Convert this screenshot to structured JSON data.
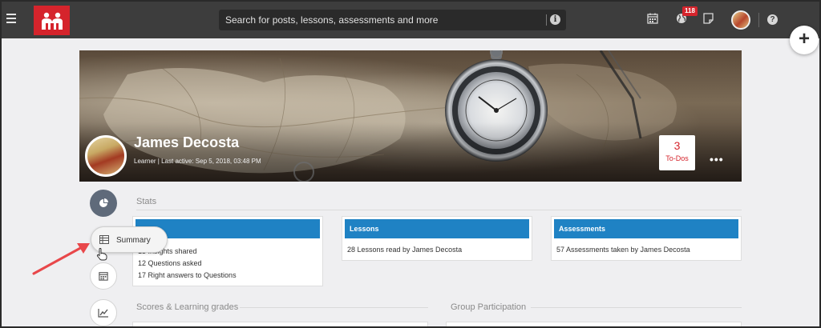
{
  "search": {
    "placeholder": "Search for posts, lessons, assessments and more"
  },
  "notifications": {
    "count": "118"
  },
  "fab": {
    "label": "+"
  },
  "profile": {
    "name": "James Decosta",
    "subtitle": "Learner | Last active: Sep 5, 2018, 03:48 PM"
  },
  "todos": {
    "count": "3",
    "label": "To-Dos"
  },
  "more_label": "•••",
  "stats": {
    "title": "Stats",
    "cards": [
      {
        "title": "",
        "lines": [
          "13 Insights shared",
          "12 Questions asked",
          "17 Right answers to Questions"
        ]
      },
      {
        "title": "Lessons",
        "lines": [
          "28 Lessons read by James Decosta"
        ]
      },
      {
        "title": "Assessments",
        "lines": [
          "57 Assessments taken by James Decosta"
        ]
      }
    ]
  },
  "tooltip": {
    "label": "Summary"
  },
  "sections": {
    "scores_title": "Scores & Learning grades",
    "group_title": "Group Participation"
  },
  "colors": {
    "accent": "#1f82c4",
    "brand": "#d5242c",
    "topbar": "#3d3d3d",
    "arrow": "#e8474a"
  }
}
